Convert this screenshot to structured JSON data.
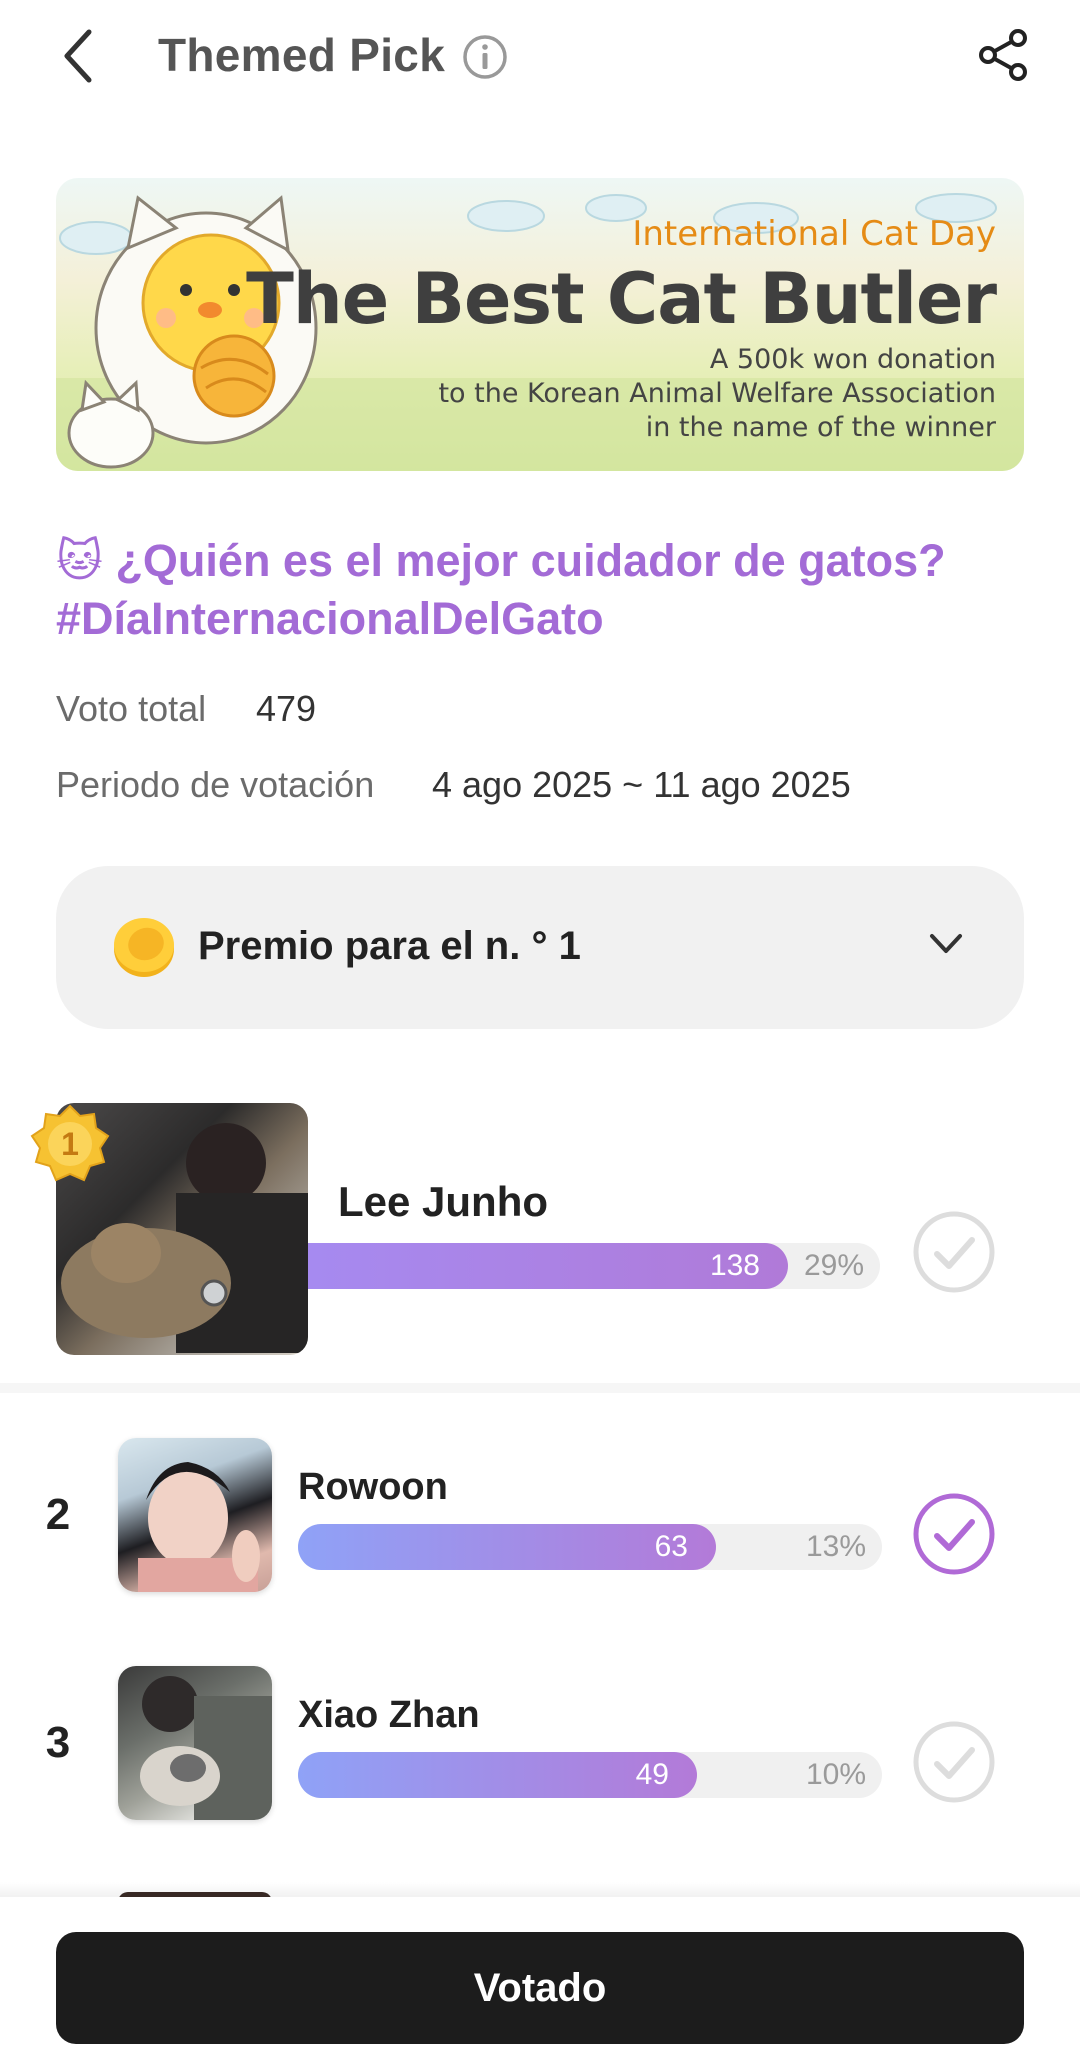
{
  "header": {
    "title": "Themed Pick",
    "back_icon": "chevron-left-icon",
    "info_icon": "info-icon",
    "share_icon": "share-icon"
  },
  "banner": {
    "subtitle": "International Cat Day",
    "title": "The Best Cat Butler",
    "line1": "A 500k won donation",
    "line2": "to the Korean Animal Welfare Association",
    "line3": "in the name of the winner"
  },
  "poll": {
    "emoji": "🐱",
    "title": "¿Quién es el mejor cuidador de gatos? #DíaInternacionalDelGato",
    "total_label": "Voto total",
    "total_value": "479",
    "period_label": "Periodo de votación",
    "period_value": "4 ago 2025 ~ 11 ago 2025"
  },
  "prize": {
    "label": "Premio para el n. ° 1",
    "icon": "coin-icon",
    "chevron": "chevron-down-icon"
  },
  "candidates": [
    {
      "rank": "1",
      "name": "Lee Junho",
      "votes": "138",
      "percent": "29%",
      "fraction": 0.29,
      "voted": false
    },
    {
      "rank": "2",
      "name": "Rowoon",
      "votes": "63",
      "percent": "13%",
      "fraction": 0.13,
      "voted": true
    },
    {
      "rank": "3",
      "name": "Xiao Zhan",
      "votes": "49",
      "percent": "10%",
      "fraction": 0.1,
      "voted": false
    }
  ],
  "colors": {
    "accent": "#a36bd6",
    "check_active": "#b06ad6",
    "check_inactive": "#dddddd",
    "button_bg": "#1c1c1c"
  },
  "footer": {
    "vote_button": "Votado"
  }
}
